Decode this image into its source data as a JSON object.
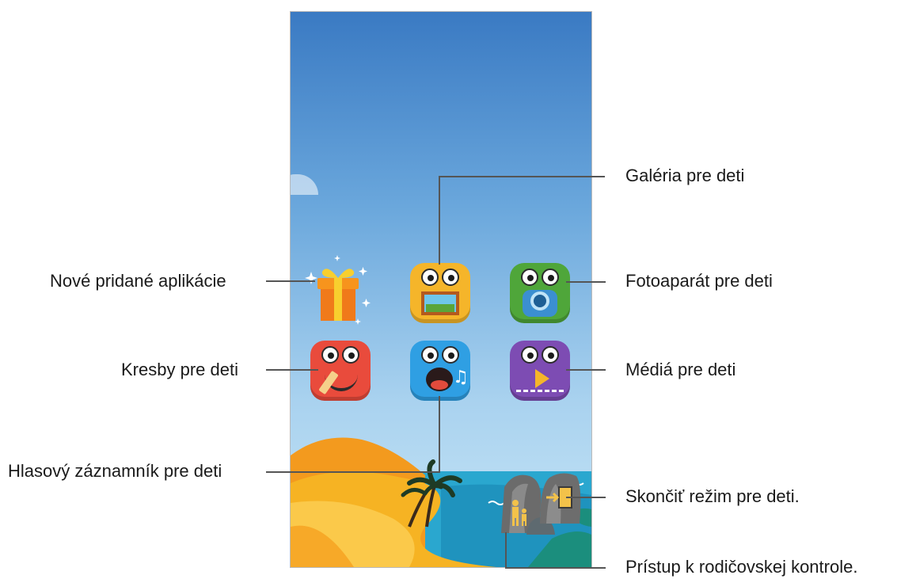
{
  "callouts": {
    "new_apps": "Nové pridané aplikácie",
    "gallery": "Galéria pre deti",
    "camera": "Fotoaparát pre deti",
    "drawing": "Kresby pre deti",
    "media": "Médiá pre deti",
    "voice_recorder": "Hlasový záznamník pre deti",
    "exit_kids_mode": "Skončiť režim pre deti.",
    "parental_control": "Prístup k rodičovskej kontrole."
  },
  "icons": {
    "new_apps": "gift-icon",
    "gallery": "kids-gallery-icon",
    "camera": "kids-camera-icon",
    "drawing": "kids-drawing-icon",
    "voice_recorder": "kids-voice-recorder-icon",
    "media": "kids-media-icon",
    "parental_control": "parental-control-rock-icon",
    "exit_kids_mode": "exit-rock-icon"
  },
  "colors": {
    "sky_top": "#3a7ac3",
    "sky_bottom": "#c8e6f6",
    "sea": "#2aa7cf",
    "sand": "#f6b323",
    "gallery_app": "#f5b52a",
    "camera_app": "#4fa63a",
    "drawing_app": "#e94b3c",
    "voice_app": "#2f9fe3",
    "media_app": "#7d4cb3",
    "gift": "#f07a1a"
  }
}
